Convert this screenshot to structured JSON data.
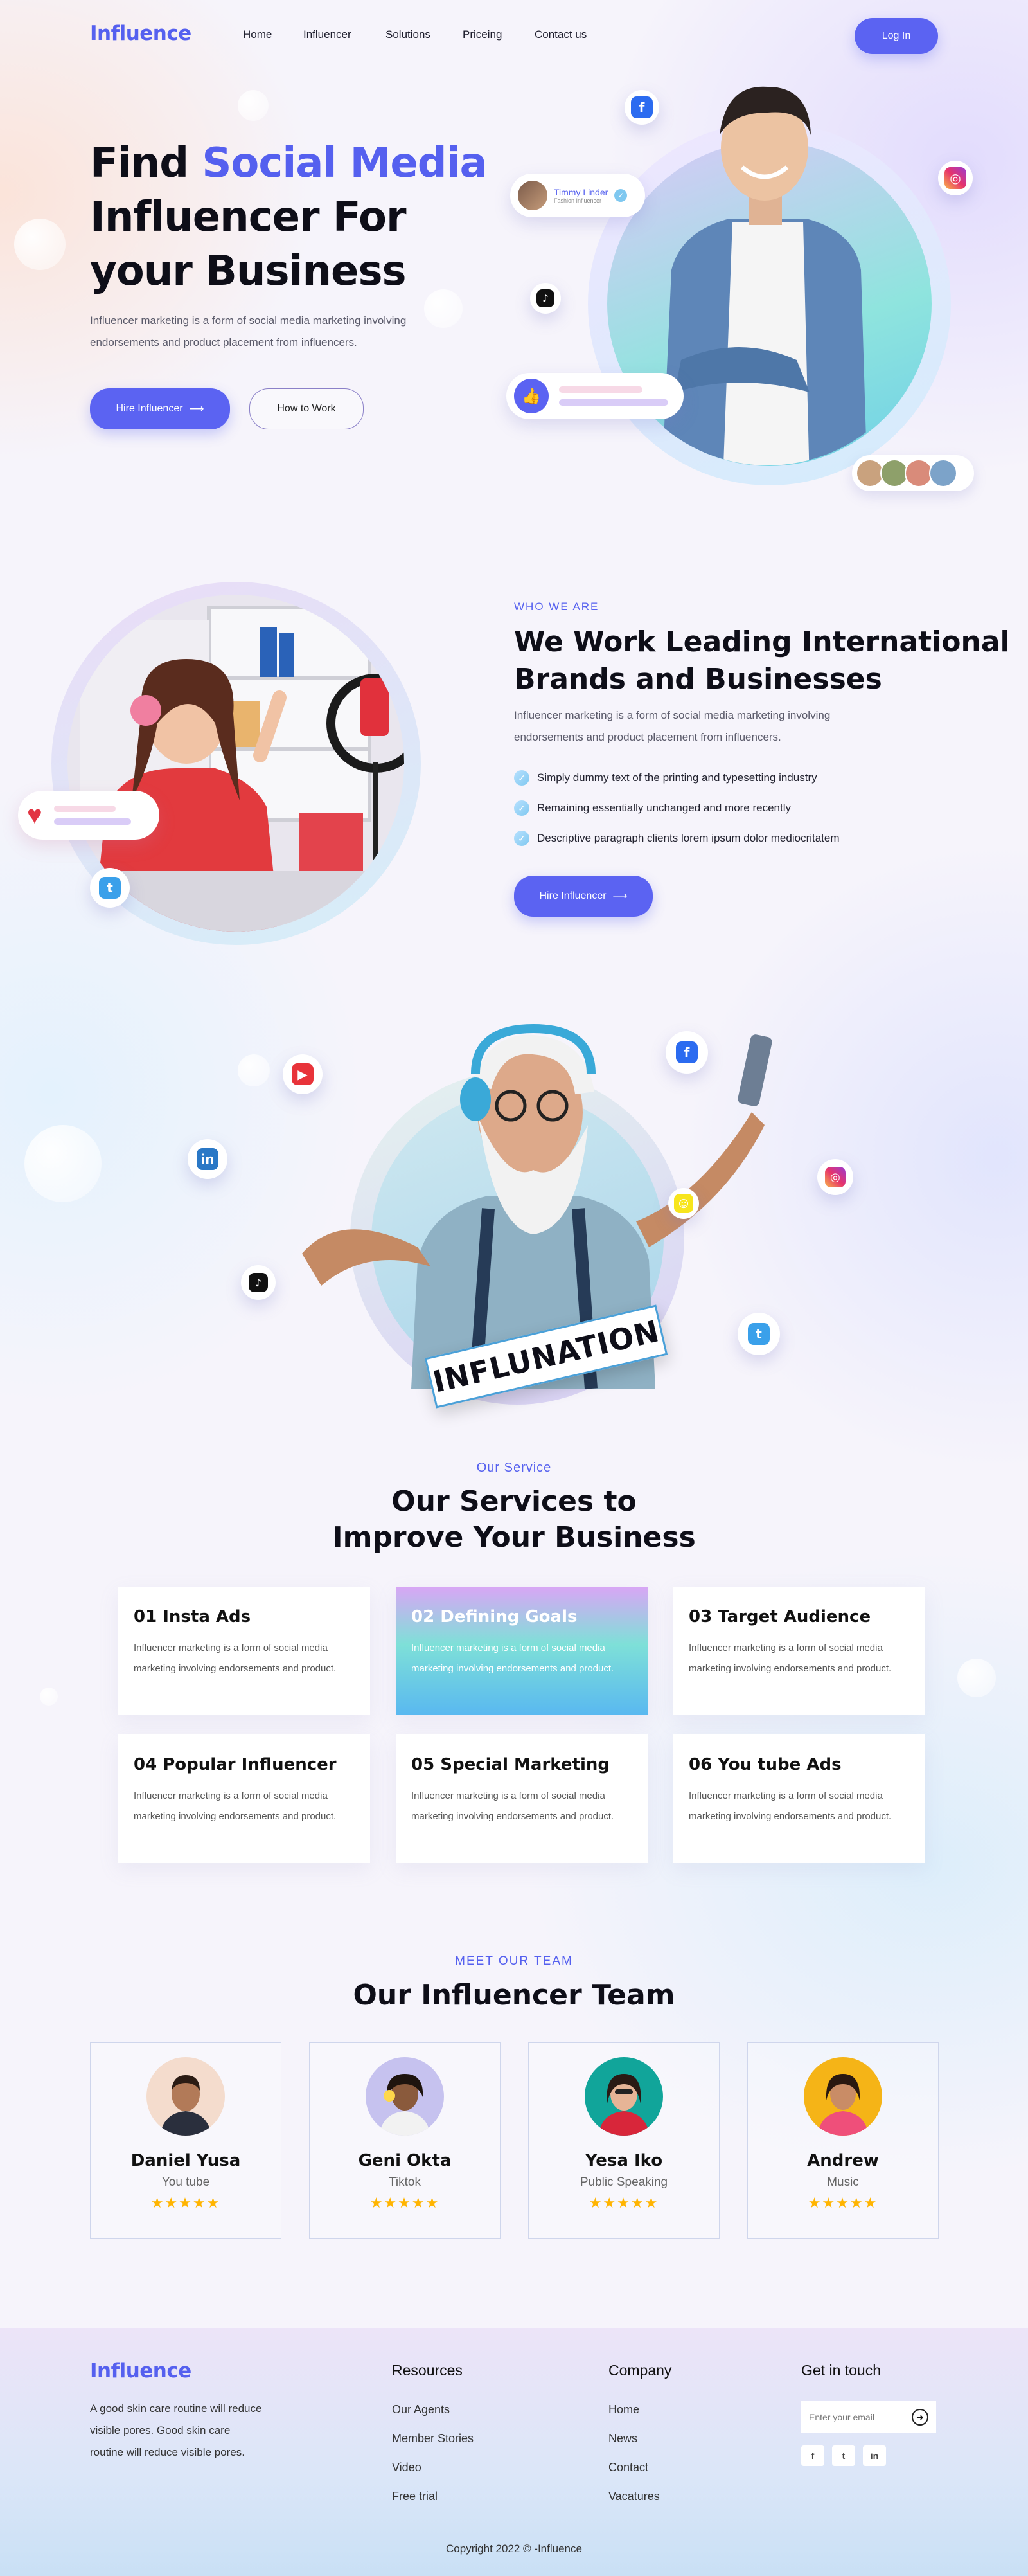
{
  "nav": {
    "logo": "Influence",
    "links": [
      "Home",
      "Influencer",
      "Solutions",
      "Priceing",
      "Contact us"
    ],
    "login_label": "Log In"
  },
  "hero": {
    "title_part1": "Find",
    "title_accent": "Social Media",
    "title_line2": "Influencer For",
    "title_line3": "your Business",
    "description": "Influencer marketing is a form of social media marketing involving endorsements and product placement from influencers.",
    "cta_primary": "Hire Influencer",
    "cta_secondary": "How to Work",
    "profile_name": "Timmy Linder",
    "profile_role": "Fashion Influencer"
  },
  "about": {
    "eyebrow": "WHO WE ARE",
    "title_line1": "We Work Leading International",
    "title_line2": "Brands and Businesses",
    "description": "Influencer marketing is a form of social media marketing involving endorsements and product placement from influencers.",
    "bullets": [
      "Simply dummy text of the printing and typesetting industry",
      "Remaining essentially unchanged and more recently",
      "Descriptive paragraph clients lorem ipsum dolor mediocritatem"
    ],
    "cta": "Hire Influencer"
  },
  "showcase": {
    "sign_text": "INFLUNATION"
  },
  "services": {
    "eyebrow": "Our Service",
    "title_line1": "Our Services to",
    "title_line2": "Improve Your Business",
    "items": [
      {
        "number": "01",
        "title": "Insta Ads",
        "text": "Influencer marketing is a form of social media marketing involving endorsements and product."
      },
      {
        "number": "02",
        "title": "Defining Goals",
        "text": "Influencer marketing is a form of social media marketing involving endorsements and product."
      },
      {
        "number": "03",
        "title": "Target Audience",
        "text": "Influencer marketing is a form of social media marketing involving endorsements and product."
      },
      {
        "number": "04",
        "title": "Popular Influencer",
        "text": "Influencer marketing is a form of social media marketing involving endorsements and product."
      },
      {
        "number": "05",
        "title": "Special Marketing",
        "text": "Influencer marketing is a form of social media marketing involving endorsements and product."
      },
      {
        "number": "06",
        "title": "You tube Ads",
        "text": "Influencer marketing is a form of social media marketing involving endorsements and product."
      }
    ]
  },
  "team": {
    "eyebrow": "MEET OUR TEAM",
    "title": "Our Influencer Team",
    "members": [
      {
        "name": "Daniel Yusa",
        "role": "You tube",
        "stars": "★★★★★"
      },
      {
        "name": "Geni Okta",
        "role": "Tiktok",
        "stars": "★★★★★"
      },
      {
        "name": "Yesa Iko",
        "role": "Public Speaking",
        "stars": "★★★★★"
      },
      {
        "name": "Andrew",
        "role": "Music",
        "stars": "★★★★★"
      }
    ]
  },
  "footer": {
    "logo": "Influence",
    "description": "A good skin care routine will reduce visible pores. Good skin care routine will reduce visible pores.",
    "resources_title": "Resources",
    "resources": [
      "Our Agents",
      "Member Stories",
      "Video",
      "Free trial"
    ],
    "company_title": "Company",
    "company": [
      "Home",
      "News",
      "Contact",
      "Vacatures"
    ],
    "contact_title": "Get in touch",
    "email_placeholder": "Enter your email",
    "copyright": "Copyright 2022 © -Influence"
  },
  "colors": {
    "accent": "#5b63f2",
    "footer_bg": "#e4e6f6",
    "star": "#ffb400"
  }
}
